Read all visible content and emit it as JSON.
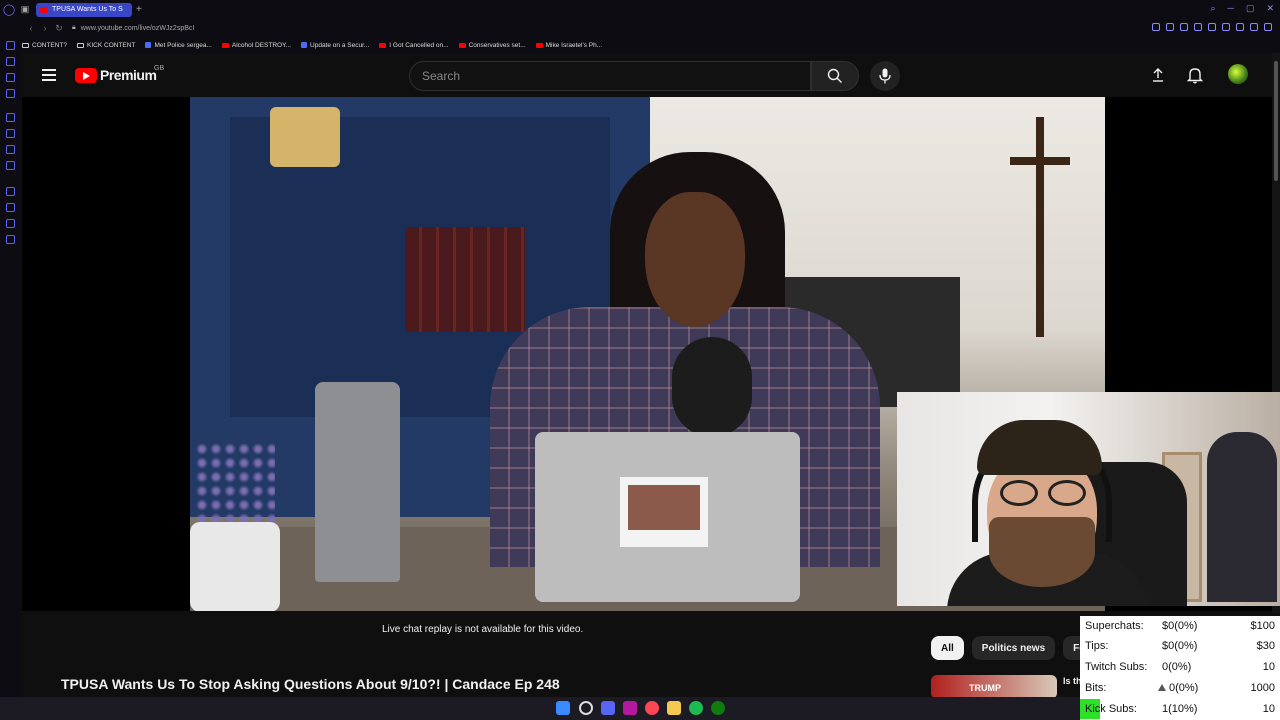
{
  "browser": {
    "tab_title": "TPUSA Wants Us To S",
    "url": "www.youtube.com/live/ozWJz2spBcI",
    "bookmarks": [
      {
        "label": "CONTENT?",
        "icon": "folder-icon"
      },
      {
        "label": "KICK CONTENT",
        "icon": "folder-icon"
      },
      {
        "label": "Met Police sergea...",
        "icon": "site-icon"
      },
      {
        "label": "Alcohol DESTROY...",
        "icon": "youtube-icon"
      },
      {
        "label": "Update on a Secur...",
        "icon": "site-icon"
      },
      {
        "label": "I Got Cancelled on...",
        "icon": "youtube-icon"
      },
      {
        "label": "Conservatives set...",
        "icon": "youtube-icon"
      },
      {
        "label": "Mike Israetel's Ph...",
        "icon": "youtube-icon"
      }
    ]
  },
  "youtube": {
    "logo_text": "Premium",
    "region": "GB",
    "search_placeholder": "Search",
    "chat_note": "Live chat replay is not available for this video.",
    "video_title": "TPUSA Wants Us To Stop Asking Questions About 9/10?! | Candace Ep 248",
    "chips": [
      "All",
      "Politics news",
      "For"
    ],
    "recommended": {
      "thumb_text": "TRUMP",
      "title": "Is th"
    }
  },
  "goals": [
    {
      "label": "Superchats:",
      "progress": "$0(0%)",
      "target": "$100",
      "fill": 0
    },
    {
      "label": "Tips:",
      "progress": "$0(0%)",
      "target": "$30",
      "fill": 0
    },
    {
      "label": "Twitch Subs:",
      "progress": "0(0%)",
      "target": "10",
      "fill": 0
    },
    {
      "label": "Bits:",
      "progress": "0(0%)",
      "target": "1000",
      "fill": 0
    },
    {
      "label": "Kick Subs:",
      "progress": "1(10%)",
      "target": "10",
      "fill": 0.1
    }
  ],
  "colors": {
    "youtube_red": "#ff0000",
    "tab_blue": "#3a46c8",
    "goal_fill": "#2fe028"
  }
}
